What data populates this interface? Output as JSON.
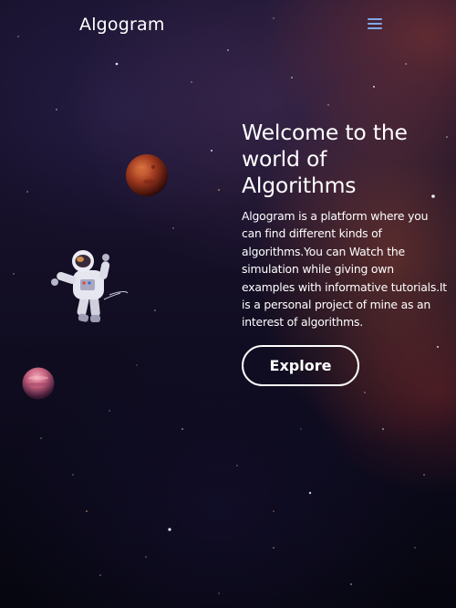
{
  "navbar": {
    "brand": "Algogram",
    "menu_icon": "hamburger-menu-icon"
  },
  "hero": {
    "title": "Welcome to the world of Algorithms",
    "description": "Algogram is a platform where you can find different kinds of algorithms.You can Watch the simulation while giving own examples with informative tutorials.It is a personal project of mine as an interest of algorithms.",
    "cta_label": "Explore"
  },
  "decorations": {
    "planet_red": "red-planet-image",
    "planet_pink": "pink-planet-image",
    "astronaut": "floating-astronaut-image"
  },
  "colors": {
    "text": "#ffffff",
    "menu_icon": "#7fa9e8",
    "background_dark": "#0b0a1a",
    "nebula": "#a8503a"
  }
}
